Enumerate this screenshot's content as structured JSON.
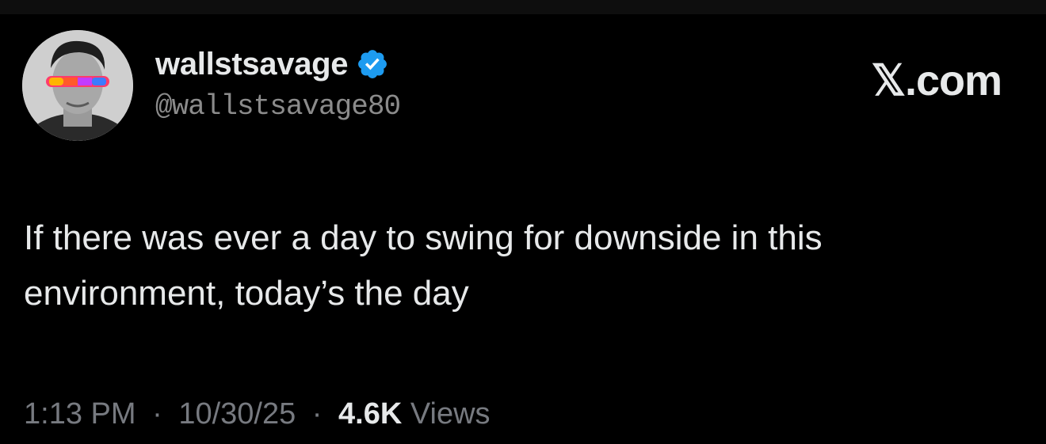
{
  "tweet": {
    "display_name": "wallstsavage",
    "handle": "@wallstsavage80",
    "verified": true,
    "text_line_1": "If there was ever a day to swing for downside in this",
    "text_line_2": "environment, today’s the day",
    "time": "1:13 PM",
    "separator": "·",
    "date": "10/30/25",
    "views_count": "4.6K",
    "views_label": "Views"
  },
  "brand": {
    "label": "𝕏.com"
  },
  "icons": {
    "verified": "verified-badge-icon",
    "avatar": "profile-avatar"
  },
  "colors": {
    "background": "#000000",
    "text": "#e7e9ea",
    "secondary": "#777a80",
    "verified_blue": "#1d9bf0"
  }
}
